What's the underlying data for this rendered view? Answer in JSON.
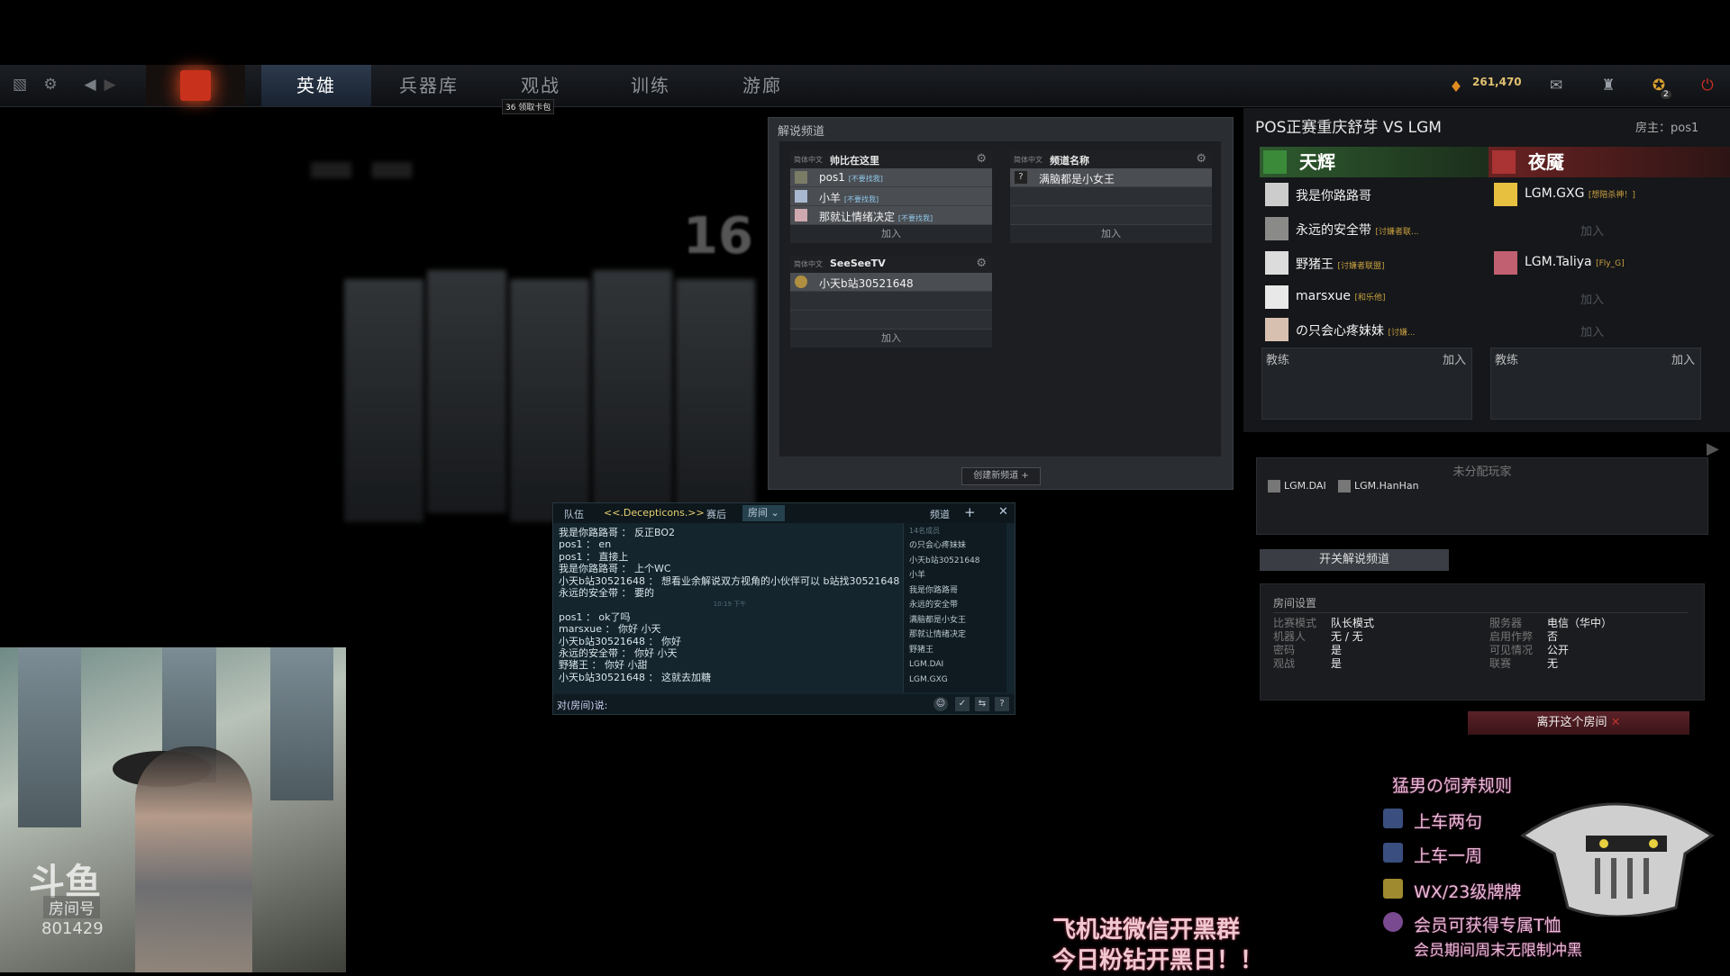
{
  "nav": {
    "tabs": [
      "英雄",
      "兵器库",
      "观战",
      "训练",
      "游廊"
    ],
    "vault_badge_num": "36",
    "vault_badge_label": "领取卡包",
    "gold": "261,470",
    "notification_count": "2"
  },
  "background": {
    "countdown": "16"
  },
  "cast_panel": {
    "title": "解说频道",
    "channels": [
      {
        "lang": "简体中文",
        "name": "帅比在这里",
        "members": [
          {
            "name": "pos1",
            "tag": "[不要找我]"
          },
          {
            "name": "小羊",
            "tag": "[不要找我]"
          },
          {
            "name": "那就让情绪决定",
            "tag": "[不要找我]"
          }
        ],
        "join": "加入"
      },
      {
        "lang": "简体中文",
        "name": "频道名称",
        "members": [
          {
            "name": "满脑都是小女王",
            "tag": ""
          }
        ],
        "join": "加入"
      },
      {
        "lang": "简体中文",
        "name": "SeeSeeTV",
        "members": [
          {
            "name": "小天b站30521648",
            "tag": ""
          }
        ],
        "join": "加入"
      }
    ],
    "create_button": "创建新频道 +"
  },
  "lobby": {
    "title": "POS正赛重庆舒芽 VS LGM",
    "host_label": "房主：pos1",
    "radiant": {
      "name": "天辉",
      "players": [
        {
          "name": "我是你路路哥",
          "tag": ""
        },
        {
          "name": "永远的安全带",
          "tag": "[讨嫌者联..."
        },
        {
          "name": "野猪王",
          "tag": "[讨嫌者联盟]"
        },
        {
          "name": "marsxue",
          "tag": "[和乐他]"
        },
        {
          "name": "の只会心疼妹妹",
          "tag": "[讨嫌..."
        }
      ]
    },
    "dire": {
      "name": "夜魇",
      "players": [
        {
          "name": "LGM.GXG",
          "tag": "[想陪杀神！]"
        },
        {
          "name": "",
          "tag": "",
          "join": "加入"
        },
        {
          "name": "LGM.Taliya",
          "tag": "[Fly_G]"
        },
        {
          "name": "",
          "tag": "",
          "join": "加入"
        },
        {
          "name": "",
          "tag": "",
          "join": "加入"
        }
      ]
    },
    "coach_label": "教练",
    "coach_join": "加入",
    "unassigned_title": "未分配玩家",
    "unassigned": [
      "LGM.DAI",
      "LGM.HanHan"
    ],
    "toggle_cast": "开关解说频道",
    "settings_title": "房间设置",
    "settings": [
      {
        "k": "比赛模式",
        "v": "队长模式"
      },
      {
        "k": "机器人",
        "v": "无 / 无"
      },
      {
        "k": "密码",
        "v": "是"
      },
      {
        "k": "观战",
        "v": "是"
      },
      {
        "k": "服务器",
        "v": "电信（华中）"
      },
      {
        "k": "启用作弊",
        "v": "否"
      },
      {
        "k": "可见情况",
        "v": "公开"
      },
      {
        "k": "联赛",
        "v": "无"
      }
    ],
    "leave": "离开这个房间"
  },
  "chat": {
    "tabs": [
      "队伍",
      "<<.Decepticons.>>",
      "赛后",
      "房间"
    ],
    "channel_label": "频道",
    "lines": [
      "我是你路路哥 ： 反正BO2",
      "pos1 ： en",
      "pos1 ： 直接上",
      "我是你路路哥 ： 上个WC",
      "小天b站30521648 ： 想看业余解说双方视角的小伙伴可以 b站找30521648",
      "永远的安全带 ： 要的",
      "10:19 下午",
      "pos1 ： ok了吗",
      "marsxue ： 你好 小天",
      "小天b站30521648 ： 你好",
      "永远的安全带 ： 你好 小天",
      "野猪王 ： 你好 小甜",
      "小天b站30521648 ： 这就去加糖"
    ],
    "member_count": "14名成员",
    "members": [
      "の只会心疼妹妹",
      "小天b站30521648",
      "小羊",
      "我是你路路哥",
      "永远的安全带",
      "满脑都是小女王",
      "那就让情绪决定",
      "野猪王",
      "LGM.DAI",
      "LGM.GXG"
    ],
    "input_prompt": "对(房间)说:"
  },
  "webcam": {
    "brand": "斗鱼",
    "room_label": "房间号",
    "room_number": "801429"
  },
  "overlay": {
    "group_ad": [
      "飞机进微信开黑群",
      "今日粉钻开黑日！！"
    ],
    "rules_title": "猛男の饲养规则",
    "rules": [
      "上车两句",
      "上车一周",
      "WX/23级牌牌",
      "会员可获得专属T恤",
      "会员期间周末无限制冲黑"
    ]
  }
}
